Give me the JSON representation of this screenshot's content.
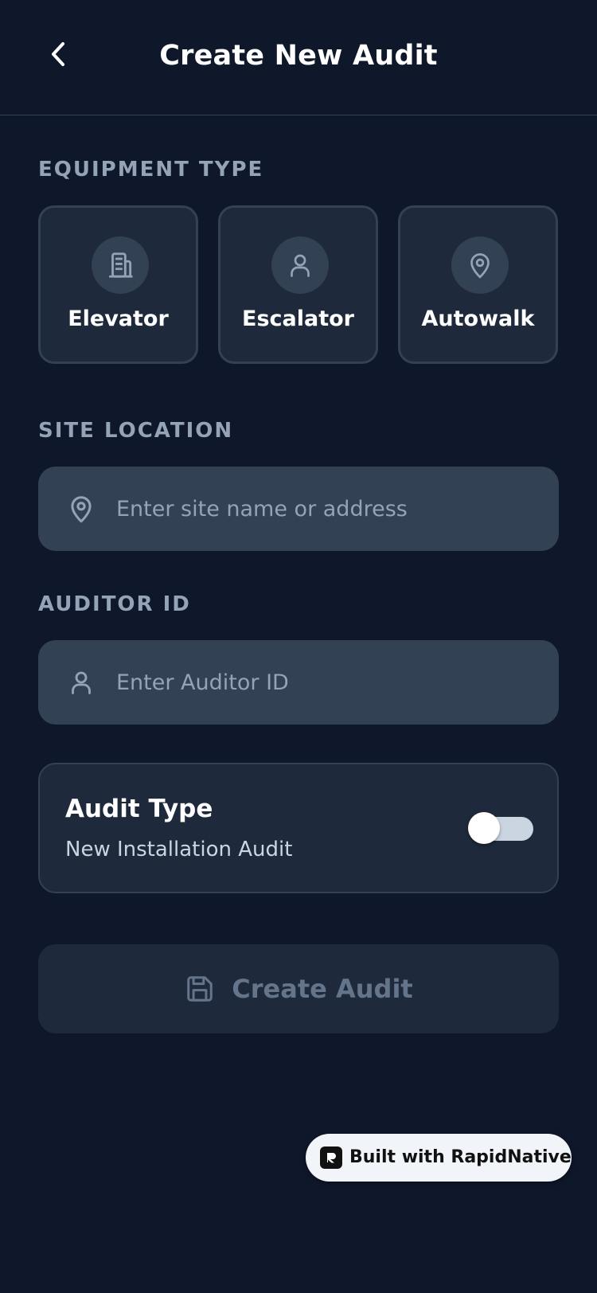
{
  "header": {
    "title": "Create New Audit",
    "back_icon": "chevron-left-icon"
  },
  "equipment": {
    "label": "EQUIPMENT TYPE",
    "options": [
      {
        "label": "Elevator",
        "icon": "building-icon"
      },
      {
        "label": "Escalator",
        "icon": "user-icon"
      },
      {
        "label": "Autowalk",
        "icon": "map-pin-icon"
      }
    ]
  },
  "site_location": {
    "label": "SITE LOCATION",
    "placeholder": "Enter site name or address",
    "value": "",
    "icon": "map-pin-icon"
  },
  "auditor": {
    "label": "AUDITOR ID",
    "placeholder": "Enter Auditor ID",
    "value": "",
    "icon": "user-icon"
  },
  "audit_type": {
    "title": "Audit Type",
    "subtitle": "New Installation Audit",
    "toggle_on": false
  },
  "create_button": {
    "label": "Create Audit",
    "icon": "save-icon",
    "enabled": false
  },
  "badge": {
    "label": "Built with RapidNative",
    "icon": "rapidnative-logo-icon"
  },
  "colors": {
    "background": "#0f172a",
    "card": "#1e293b",
    "border": "#334155",
    "input": "#334155",
    "muted_text": "#94a3b8",
    "disabled_text": "#64748b"
  }
}
